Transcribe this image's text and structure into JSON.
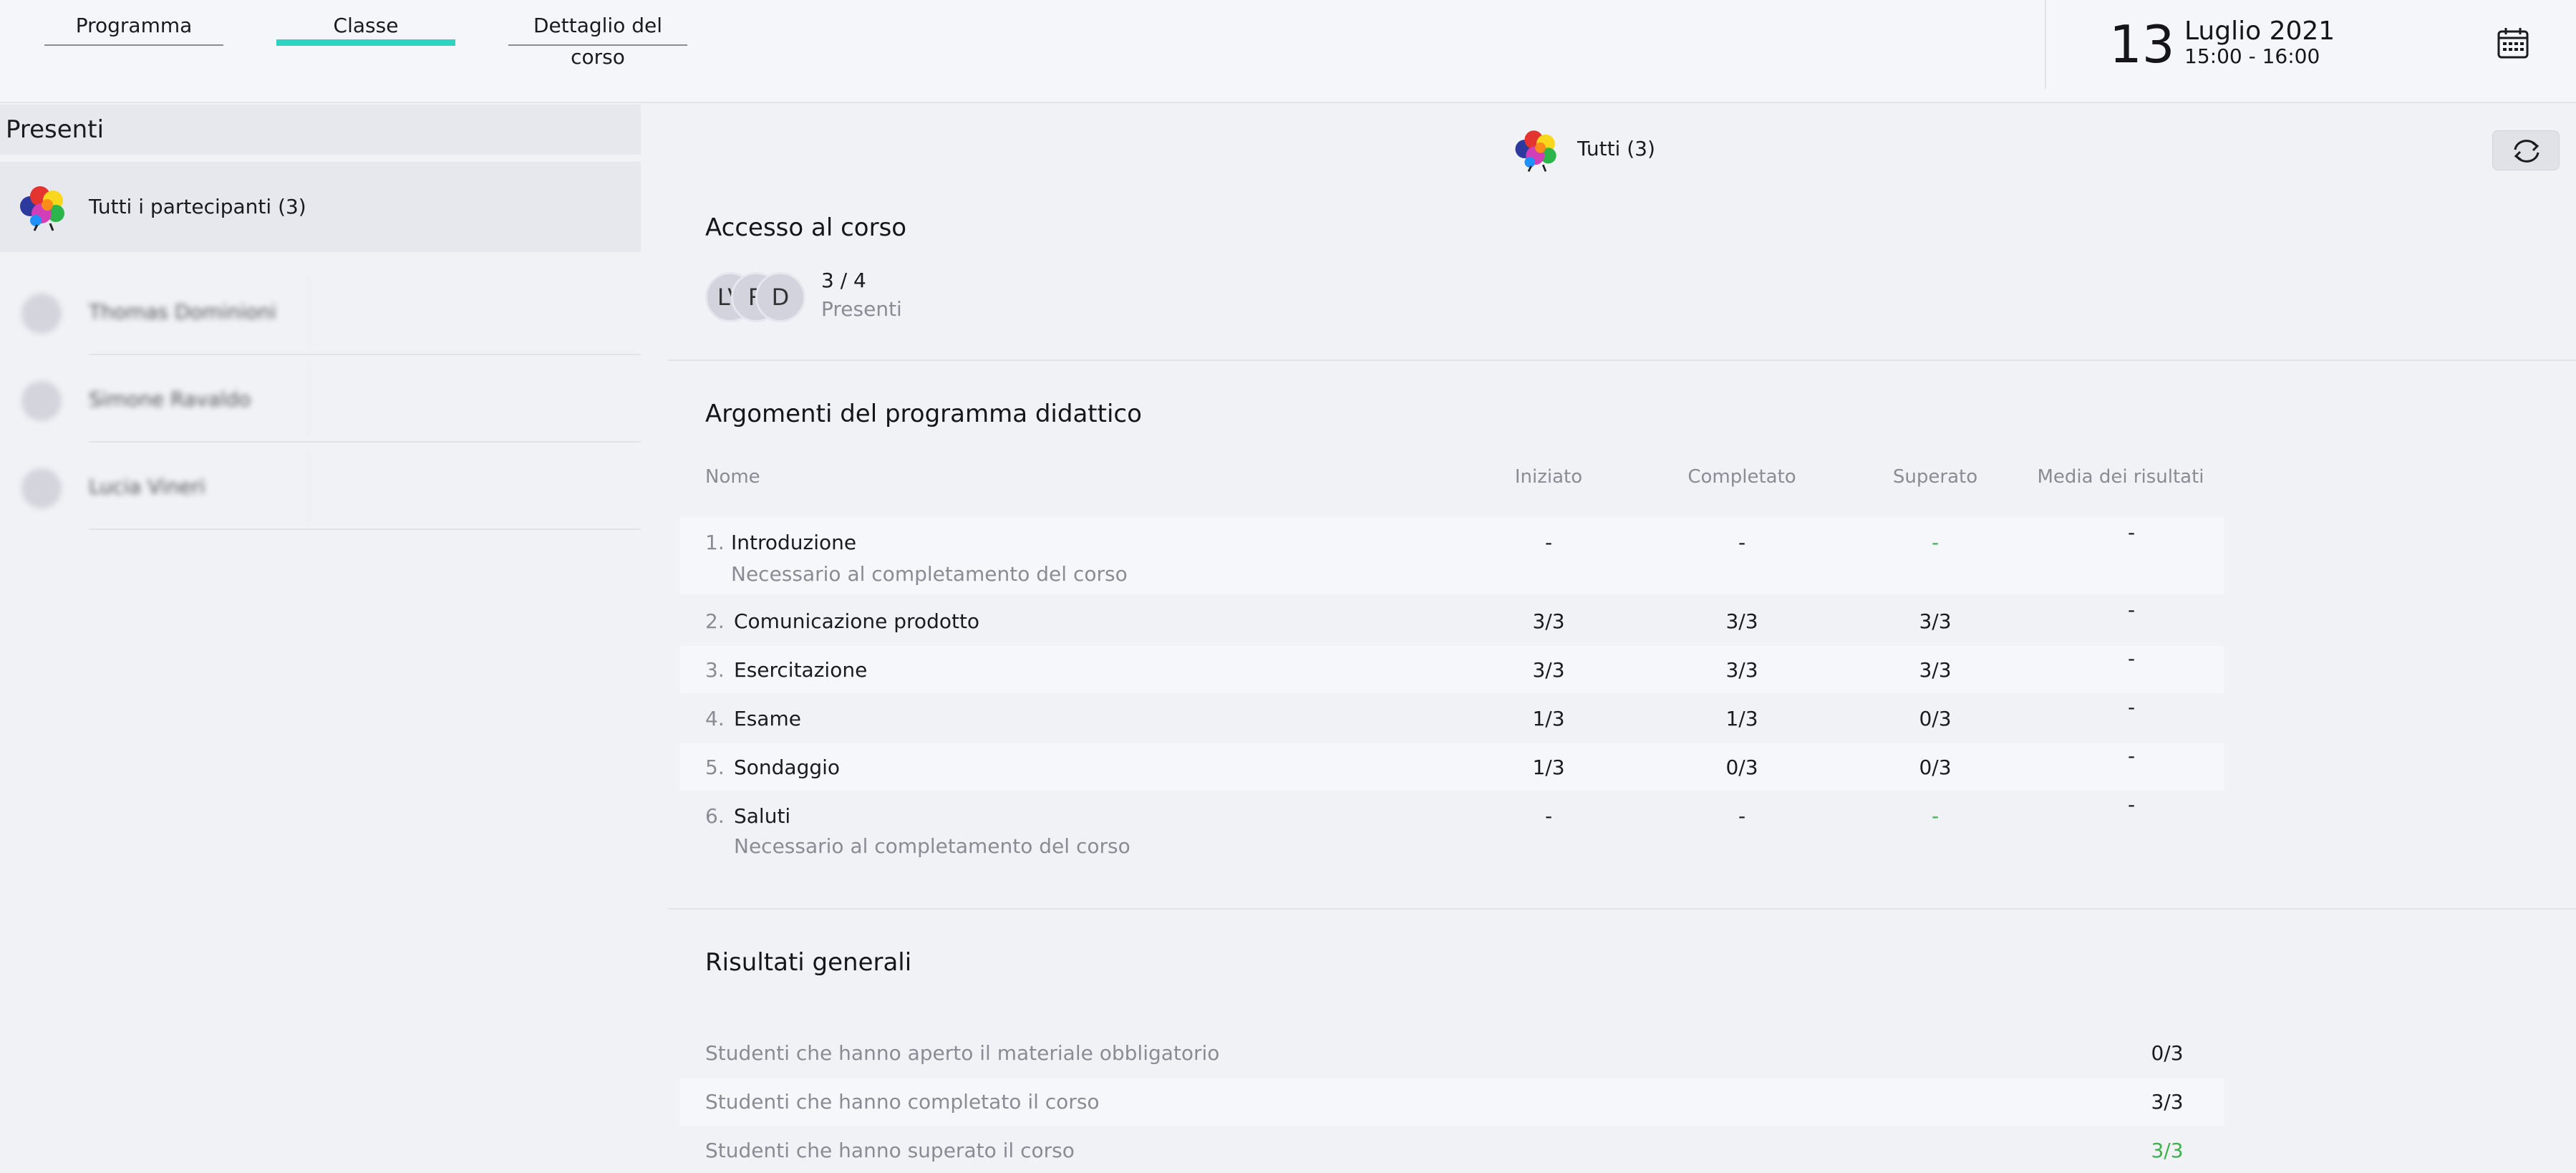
{
  "tabs": [
    {
      "label": "Programma"
    },
    {
      "label": "Classe",
      "active": true
    },
    {
      "label": "Dettaglio del corso"
    }
  ],
  "date": {
    "day": "13",
    "month_year": "Luglio 2021",
    "time": "15:00 - 16:00",
    "icon": "calendar-icon"
  },
  "left": {
    "title": "Presenti",
    "all_label": "Tutti i partecipanti (3)",
    "participants": [
      {
        "name": "Thomas Dominioni"
      },
      {
        "name": "Simone Ravaldo"
      },
      {
        "name": "Lucia Vineri"
      }
    ]
  },
  "header": {
    "label": "Tutti (3)",
    "refresh_icon": "refresh-icon"
  },
  "access": {
    "title": "Accesso al corso",
    "avatars": [
      "LV",
      "R",
      "D"
    ],
    "count": "3 / 4",
    "label": "Presenti"
  },
  "topics": {
    "title": "Argomenti del programma didattico",
    "columns": [
      "Nome",
      "Iniziato",
      "Completato",
      "Superato",
      "Media dei risultati"
    ],
    "rows": [
      {
        "num": "1.",
        "name": "Introduzione",
        "note": "Necessario al completamento del corso",
        "started": "-",
        "completed": "-",
        "passed": "-",
        "avg": "-"
      },
      {
        "num": "2.",
        "name": "Comunicazione prodotto",
        "note": "",
        "started": "3/3",
        "completed": "3/3",
        "passed": "3/3",
        "avg": "-"
      },
      {
        "num": "3.",
        "name": "Esercitazione",
        "note": "",
        "started": "3/3",
        "completed": "3/3",
        "passed": "3/3",
        "avg": "-"
      },
      {
        "num": "4.",
        "name": "Esame",
        "note": "",
        "started": "1/3",
        "completed": "1/3",
        "passed": "0/3",
        "avg": "-"
      },
      {
        "num": "5.",
        "name": "Sondaggio",
        "note": "",
        "started": "1/3",
        "completed": "0/3",
        "passed": "0/3",
        "avg": "-"
      },
      {
        "num": "6.",
        "name": "Saluti",
        "note": "Necessario al completamento del corso",
        "started": "-",
        "completed": "-",
        "passed": "-",
        "avg": "-"
      }
    ]
  },
  "results": {
    "title": "Risultati generali",
    "rows": [
      {
        "label": "Studenti che hanno aperto il materiale obbligatorio",
        "value": "0/3"
      },
      {
        "label": "Studenti che hanno completato il corso",
        "value": "3/3"
      },
      {
        "label": "Studenti che hanno superato il corso",
        "value": "3/3"
      }
    ]
  },
  "colors": {
    "accent": "#2dd4c2",
    "success": "#3bb24c",
    "muted": "#8a8b94"
  }
}
